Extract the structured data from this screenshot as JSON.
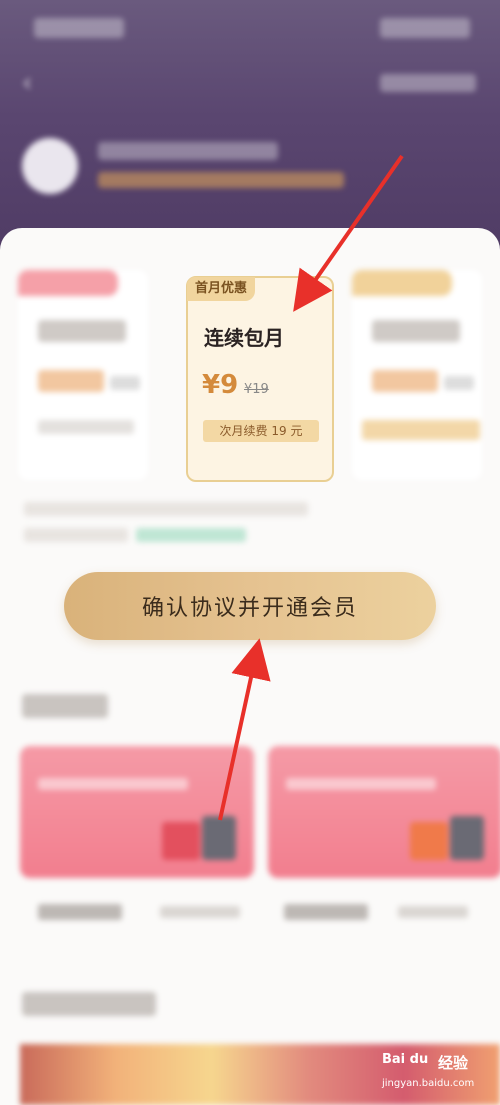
{
  "plan_card": {
    "badge": "首月优惠",
    "title": "连续包月",
    "price": "¥9",
    "original_price": "¥19",
    "renewal_note": "次月续费 19 元"
  },
  "cta": {
    "label": "确认协议并开通会员"
  },
  "watermark": {
    "logo": "Bai du",
    "brand": "经验",
    "url": "jingyan.baidu.com"
  },
  "colors": {
    "header_purple": "#5a4670",
    "accent_gold": "#e5c290",
    "price_orange": "#d48a3b",
    "arrow_red": "#e8302a"
  }
}
